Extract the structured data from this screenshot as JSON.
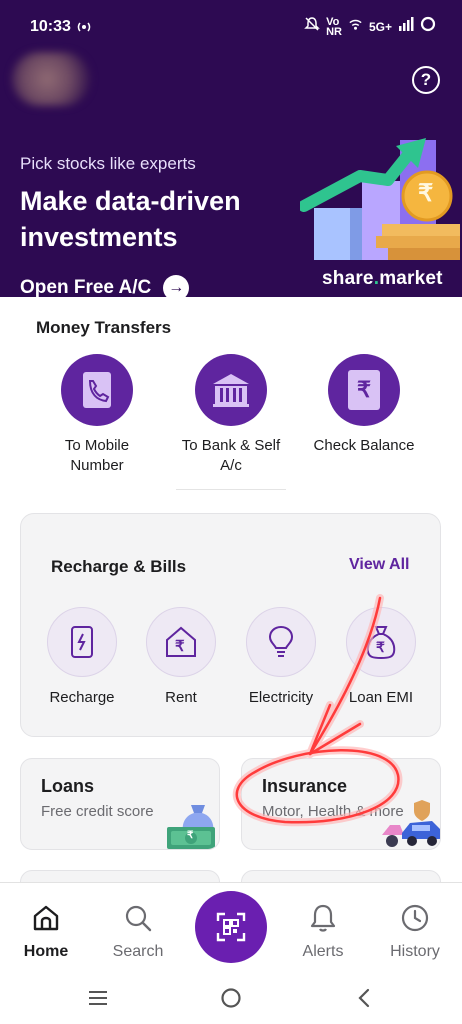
{
  "status_bar": {
    "time": "10:33",
    "net_label_top": "Vo",
    "net_label_bottom": "NR",
    "network": "5G+"
  },
  "header": {
    "help_glyph": "?",
    "banner": {
      "subtitle": "Pick stocks like experts",
      "title": "Make data-driven investments",
      "cta": "Open Free A/C",
      "brand_left": "share",
      "brand_right": "market",
      "rupee_glyph": "₹"
    }
  },
  "money_transfers": {
    "title": "Money Transfers",
    "items": [
      {
        "label": "To Mobile Number",
        "icon": "phone-icon"
      },
      {
        "label": "To Bank & Self A/c",
        "icon": "bank-icon"
      },
      {
        "label": "Check Balance",
        "icon": "rupee-book-icon",
        "glyph": "₹"
      }
    ]
  },
  "recharge_bills": {
    "title": "Recharge & Bills",
    "view_all": "View All",
    "items": [
      {
        "label": "Recharge",
        "icon": "mobile-recharge-icon"
      },
      {
        "label": "Rent",
        "icon": "house-rupee-icon",
        "glyph": "₹"
      },
      {
        "label": "Electricity",
        "icon": "bulb-icon"
      },
      {
        "label": "Loan EMI",
        "icon": "money-bag-icon",
        "glyph": "₹"
      }
    ]
  },
  "cards": {
    "loans": {
      "title": "Loans",
      "subtitle": "Free credit score",
      "glyph": "₹"
    },
    "insurance": {
      "title": "Insurance",
      "subtitle": "Motor, Health & more"
    }
  },
  "bottom_nav": {
    "items": [
      {
        "label": "Home",
        "icon": "home-icon",
        "active": true
      },
      {
        "label": "Search",
        "icon": "search-icon"
      },
      {
        "label": "Alerts",
        "icon": "bell-icon"
      },
      {
        "label": "History",
        "icon": "clock-icon"
      }
    ],
    "scan_icon": "qr-scan-icon"
  },
  "colors": {
    "brand_purple": "#5f259f",
    "header_bg": "#2d0a52",
    "annotation_red": "#ff3b3b"
  }
}
